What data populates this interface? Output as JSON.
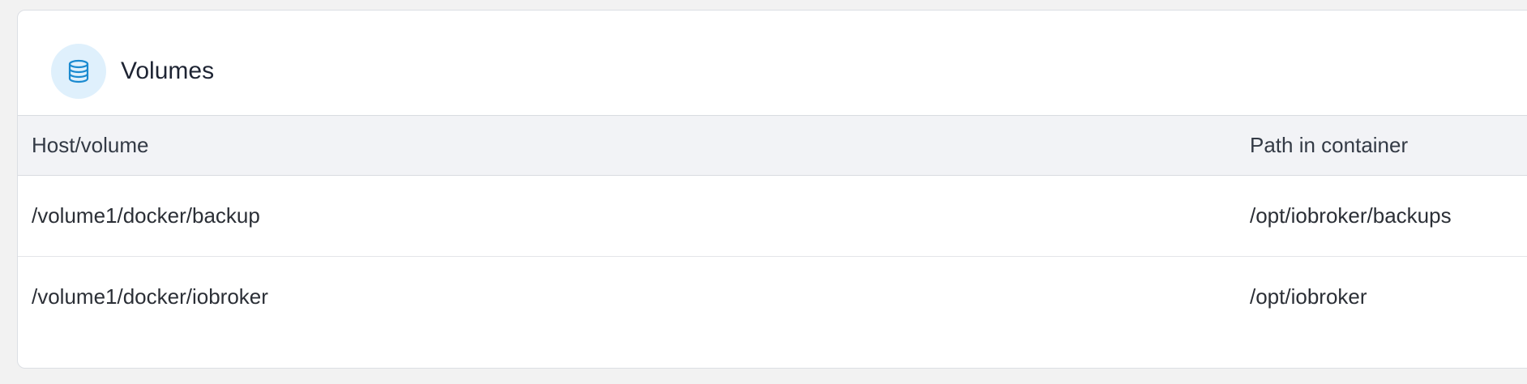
{
  "panel": {
    "title": "Volumes",
    "icon": "database-icon",
    "accent_color": "#1a8ad0",
    "icon_bg_color": "#dff0fc"
  },
  "table": {
    "columns": [
      "Host/volume",
      "Path in container"
    ],
    "rows": [
      {
        "host": "/volume1/docker/backup",
        "path": "/opt/iobroker/backups"
      },
      {
        "host": "/volume1/docker/iobroker",
        "path": "/opt/iobroker"
      }
    ]
  }
}
